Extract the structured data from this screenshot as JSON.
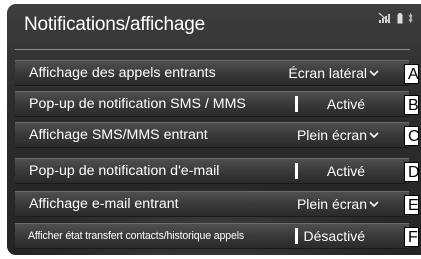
{
  "header": {
    "title": "Notifications/affichage",
    "icons": [
      "no-signal-icon",
      "battery-icon",
      "bluetooth-icon"
    ]
  },
  "rows": [
    {
      "label": "Affichage des appels entrants",
      "value": "Écran latéral",
      "control": "dropdown",
      "callout": "A"
    },
    {
      "label": "Pop-up de notification SMS / MMS",
      "value": "Activé",
      "control": "toggle",
      "callout": "B"
    },
    {
      "label": "Affichage SMS/MMS entrant",
      "value": "Plein écran",
      "control": "dropdown",
      "callout": "C"
    },
    {
      "label": "Pop-up de notification d'e-mail",
      "value": "Activé",
      "control": "toggle",
      "callout": "D"
    },
    {
      "label": "Affichage e-mail entrant",
      "value": "Plein écran",
      "control": "dropdown",
      "callout": "E"
    },
    {
      "label": "Afficher état transfert contacts/historique appels",
      "value": "Désactivé",
      "control": "toggle",
      "callout": "F"
    }
  ]
}
